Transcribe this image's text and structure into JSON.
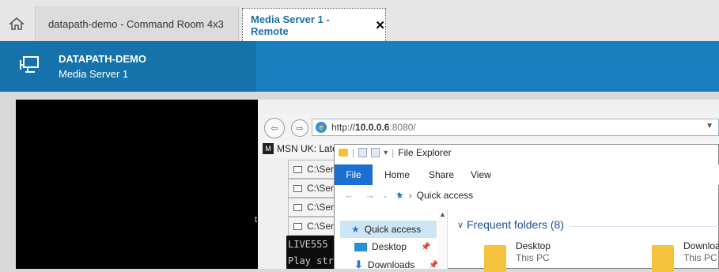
{
  "tabs": {
    "tab1_label": "datapath-demo - Command Room 4x3",
    "tab2_label": "Media Server 1 - Remote",
    "tab2_close": "✕"
  },
  "header": {
    "title": "DATAPATH-DEMO",
    "subtitle": "Media Server 1"
  },
  "browser": {
    "address_prefix": "http://",
    "address_host": "10.0.0.6",
    "address_port": ":8080/",
    "favorite_label": "MSN UK: Late"
  },
  "taskwindows": [
    "C:\\Ser",
    "C:\\Ser",
    "C:\\Ser",
    "C:\\Ser"
  ],
  "console_lines": [
    "LIVE555",
    "Play str"
  ],
  "black_text": "t",
  "explorer": {
    "title": "File Explorer",
    "ribbon_tabs": [
      "File",
      "Home",
      "Share",
      "View"
    ],
    "breadcrumb": "Quick access",
    "sidebar": [
      "Quick access",
      "Desktop",
      "Downloads"
    ],
    "section_heading": "Frequent folders (8)",
    "folders": [
      {
        "name": "Desktop",
        "sub": "This PC"
      },
      {
        "name": "Downloa",
        "sub": "This PC"
      }
    ]
  },
  "colors": {
    "header_bg": "#1a7fbf",
    "header_left_bg": "#1672ab",
    "active_tab_text": "#1a6fa8",
    "file_tab_bg": "#1a6fd1"
  }
}
